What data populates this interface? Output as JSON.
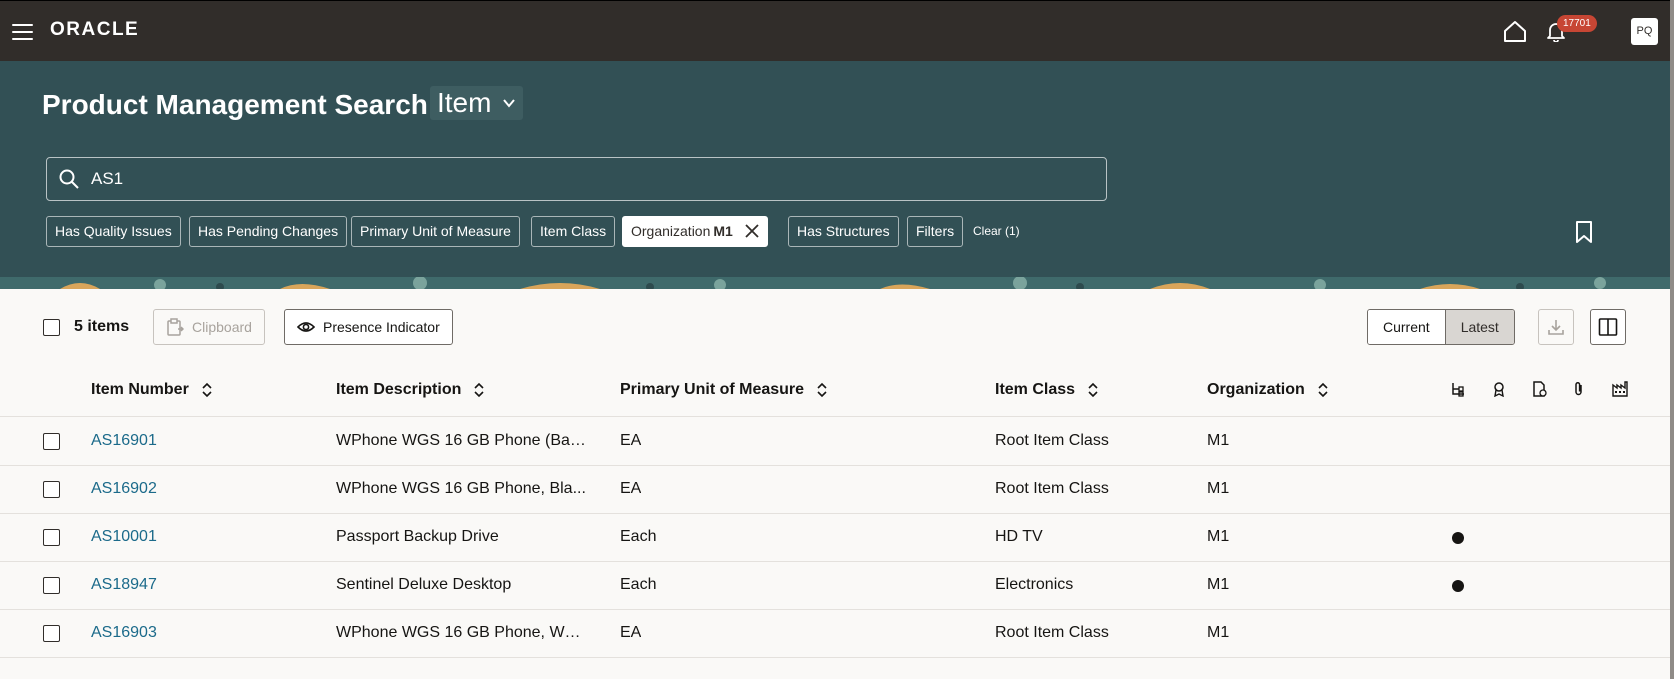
{
  "topbar": {
    "logo": "ORACLE",
    "notification_count": "17701",
    "avatar_initials": "PQ"
  },
  "header": {
    "title": "Product Management Search",
    "type_select": "Item",
    "search_value": "AS1",
    "chips": [
      {
        "label": "Has Quality Issues"
      },
      {
        "label": "Has Pending Changes"
      },
      {
        "label": "Primary Unit of Measure"
      },
      {
        "label": "Item Class"
      },
      {
        "label": "Organization",
        "value": "M1"
      },
      {
        "label": "Has Structures"
      },
      {
        "label": "Filters"
      }
    ],
    "clear_label": "Clear (1)"
  },
  "toolbar": {
    "items_count": "5 items",
    "clipboard_label": "Clipboard",
    "presence_label": "Presence Indicator",
    "current_label": "Current",
    "latest_label": "Latest"
  },
  "table": {
    "columns": [
      "Item Number",
      "Item Description",
      "Primary Unit of Measure",
      "Item Class",
      "Organization"
    ],
    "indicator_icons": [
      "structure-icon",
      "award-icon",
      "document-change-icon",
      "attachment-icon",
      "factory-icon"
    ],
    "rows": [
      {
        "number": "AS16901",
        "description": "WPhone WGS 16 GB Phone (Bas...",
        "uom": "EA",
        "item_class": "Root Item Class",
        "org": "M1",
        "has_indicator": false
      },
      {
        "number": "AS16902",
        "description": "WPhone WGS 16 GB Phone, Bla...",
        "uom": "EA",
        "item_class": "Root Item Class",
        "org": "M1",
        "has_indicator": false
      },
      {
        "number": "AS10001",
        "description": "Passport Backup Drive",
        "uom": "Each",
        "item_class": "HD TV",
        "org": "M1",
        "has_indicator": true
      },
      {
        "number": "AS18947",
        "description": "Sentinel Deluxe Desktop",
        "uom": "Each",
        "item_class": "Electronics",
        "org": "M1",
        "has_indicator": true
      },
      {
        "number": "AS16903",
        "description": "WPhone WGS 16 GB Phone, Whi...",
        "uom": "EA",
        "item_class": "Root Item Class",
        "org": "M1",
        "has_indicator": false
      }
    ]
  },
  "colors": {
    "topbar": "#312d2a",
    "header": "#325055",
    "link": "#1b6a8a",
    "badge": "#c74634"
  }
}
